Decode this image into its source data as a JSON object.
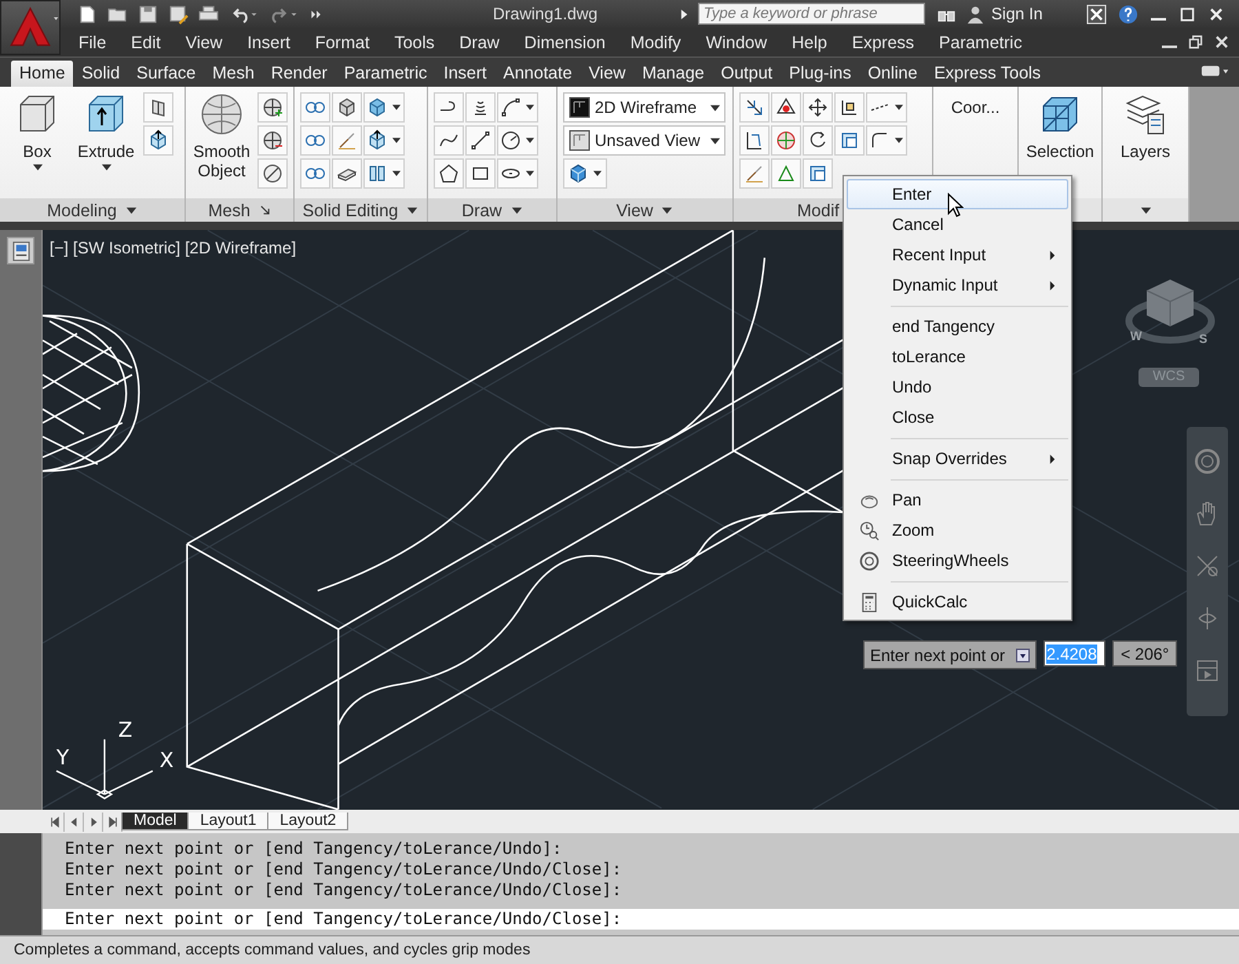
{
  "title_bar": {
    "title": "Drawing1.dwg",
    "search": {
      "placeholder": "Type a keyword or phrase"
    },
    "sign_in": "Sign In"
  },
  "menu_bar": [
    "File",
    "Edit",
    "View",
    "Insert",
    "Format",
    "Tools",
    "Draw",
    "Dimension",
    "Modify",
    "Window",
    "Help",
    "Express",
    "Parametric"
  ],
  "ribbon_tabs": [
    {
      "label": "Home",
      "selected": true
    },
    {
      "label": "Solid",
      "selected": false
    },
    {
      "label": "Surface",
      "selected": false
    },
    {
      "label": "Mesh",
      "selected": false
    },
    {
      "label": "Render",
      "selected": false
    },
    {
      "label": "Parametric",
      "selected": false
    },
    {
      "label": "Insert",
      "selected": false
    },
    {
      "label": "Annotate",
      "selected": false
    },
    {
      "label": "View",
      "selected": false
    },
    {
      "label": "Manage",
      "selected": false
    },
    {
      "label": "Output",
      "selected": false
    },
    {
      "label": "Plug-ins",
      "selected": false
    },
    {
      "label": "Online",
      "selected": false
    },
    {
      "label": "Express Tools",
      "selected": false
    }
  ],
  "ribbon_panels": [
    {
      "kind": "modeling",
      "title": "Modeling",
      "buttons": [
        {
          "label": "Box"
        },
        {
          "label": "Extrude"
        }
      ]
    },
    {
      "kind": "mesh",
      "title": "Mesh",
      "buttons": [
        {
          "label": "Smooth Object"
        }
      ]
    },
    {
      "kind": "solid_editing",
      "title": "Solid Editing"
    },
    {
      "kind": "draw",
      "title": "Draw"
    },
    {
      "kind": "view",
      "title": "View",
      "dropdowns": [
        {
          "value": "2D Wireframe"
        },
        {
          "value": "Unsaved View"
        }
      ]
    },
    {
      "kind": "modify",
      "title": "Modif"
    },
    {
      "kind": "text",
      "buttons": [
        {
          "label": "Coor..."
        }
      ]
    },
    {
      "kind": "selection",
      "buttons": [
        {
          "label": "Selection"
        }
      ]
    },
    {
      "kind": "layers",
      "buttons": [
        {
          "label": "Layers"
        }
      ]
    }
  ],
  "viewport": {
    "label": "[−] [SW Isometric] [2D Wireframe]",
    "ucs": {
      "x": "X",
      "y": "Y",
      "z": "Z"
    },
    "view_cube": {
      "compass": [
        "W",
        "S"
      ],
      "coordinate_system": "WCS"
    }
  },
  "context_menu": {
    "groups": [
      [
        {
          "label": "Enter",
          "highlighted": true,
          "submenu": false
        },
        {
          "label": "Cancel",
          "highlighted": false,
          "submenu": false
        },
        {
          "label": "Recent Input",
          "highlighted": false,
          "submenu": true
        },
        {
          "label": "Dynamic Input",
          "highlighted": false,
          "submenu": true
        }
      ],
      [
        {
          "label": "end Tangency",
          "highlighted": false,
          "submenu": false
        },
        {
          "label": "toLerance",
          "highlighted": false,
          "submenu": false
        },
        {
          "label": "Undo",
          "highlighted": false,
          "submenu": false
        },
        {
          "label": "Close",
          "highlighted": false,
          "submenu": false
        }
      ],
      [
        {
          "label": "Snap Overrides",
          "highlighted": false,
          "submenu": true
        }
      ],
      [
        {
          "label": "Pan",
          "highlighted": false,
          "submenu": false
        },
        {
          "label": "Zoom",
          "highlighted": false,
          "submenu": false
        },
        {
          "label": "SteeringWheels",
          "highlighted": false,
          "submenu": false
        }
      ],
      [
        {
          "label": "QuickCalc",
          "highlighted": false,
          "submenu": false
        }
      ]
    ]
  },
  "dynamic_input": {
    "prompt": "Enter next point or",
    "value": "2.4208",
    "angle": "< 206°"
  },
  "layout_tabs": [
    {
      "label": "Model",
      "selected": true
    },
    {
      "label": "Layout1",
      "selected": false
    },
    {
      "label": "Layout2",
      "selected": false
    }
  ],
  "command_history": [
    "Enter next point or [end Tangency/toLerance/Undo]:",
    "Enter next point or [end Tangency/toLerance/Undo/Close]:",
    "Enter next point or [end Tangency/toLerance/Undo/Close]:"
  ],
  "command_line": "Enter next point or [end Tangency/toLerance/Undo/Close]:",
  "status_bar": "Completes a command, accepts command values, and cycles grip modes"
}
